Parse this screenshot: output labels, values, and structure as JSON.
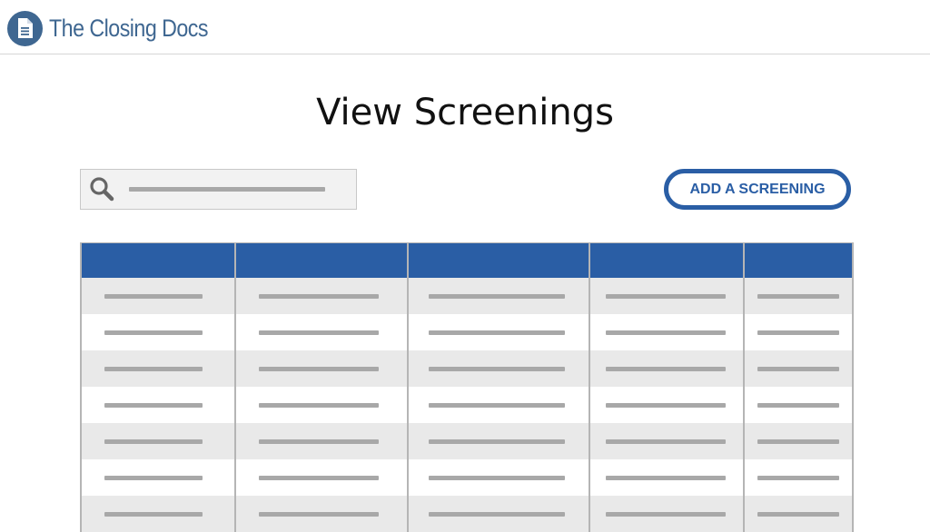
{
  "brand": {
    "name": "The Closing Docs",
    "color": "#3f6791"
  },
  "page": {
    "title": "View Screenings"
  },
  "toolbar": {
    "search_icon": "search-icon",
    "add_button_label": "ADD A SCREENING",
    "accent": "#2a5ea5"
  },
  "table": {
    "columns": 5,
    "visible_rows": 7,
    "header_color": "#2a5ea5"
  }
}
